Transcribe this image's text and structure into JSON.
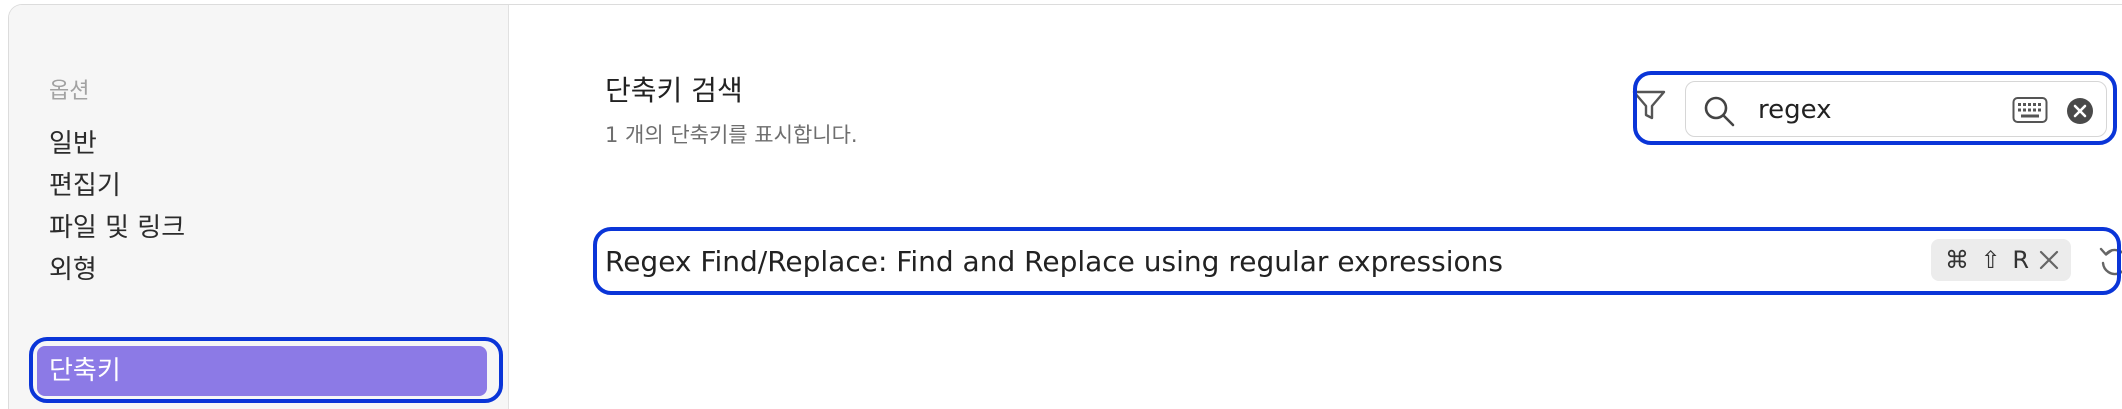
{
  "sidebar": {
    "heading": "옵션",
    "items": [
      {
        "label": "일반"
      },
      {
        "label": "편집기"
      },
      {
        "label": "파일 및 링크"
      },
      {
        "label": "외형"
      },
      {
        "label": "단축키",
        "active": true
      }
    ]
  },
  "main": {
    "title": "단축키 검색",
    "subtitle": "1 개의 단축키를 표시합니다.",
    "search": {
      "value": "regex"
    },
    "hotkeys": [
      {
        "label": "Regex Find/Replace: Find and Replace using regular expressions",
        "keys": "⌘ ⇧ R"
      }
    ]
  },
  "colors": {
    "accent": "#8c7ae6",
    "highlight": "#0a35d8"
  },
  "icons": [
    "filter-icon",
    "search-icon",
    "keyboard-icon",
    "clear-icon",
    "close-icon",
    "reset-icon",
    "add-icon"
  ]
}
